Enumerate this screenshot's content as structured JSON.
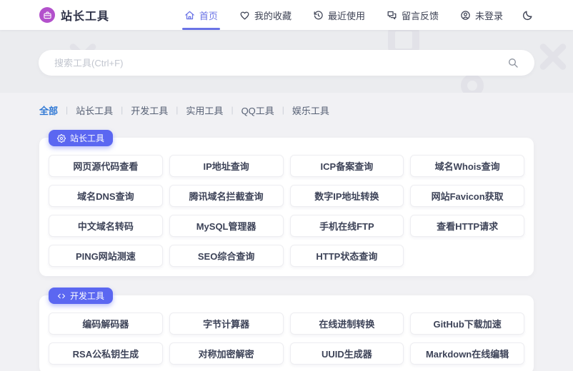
{
  "header": {
    "brand": "站长工具",
    "logo_icon": "toolbox-icon",
    "nav": [
      {
        "label": "首页",
        "icon": "home-icon",
        "active": true
      },
      {
        "label": "我的收藏",
        "icon": "heart-icon",
        "active": false
      },
      {
        "label": "最近使用",
        "icon": "history-icon",
        "active": false
      },
      {
        "label": "留言反馈",
        "icon": "feedback-icon",
        "active": false
      },
      {
        "label": "未登录",
        "icon": "user-icon",
        "active": false
      }
    ],
    "theme_toggle_icon": "moon-icon"
  },
  "search": {
    "placeholder": "搜索工具(Ctrl+F)",
    "icon": "search-icon"
  },
  "categories": {
    "active": "全部",
    "items": [
      "全部",
      "站长工具",
      "开发工具",
      "实用工具",
      "QQ工具",
      "娱乐工具"
    ]
  },
  "sections": [
    {
      "title": "站长工具",
      "icon": "gear-icon",
      "tools": [
        "网页源代码查看",
        "IP地址查询",
        "ICP备案查询",
        "域名Whois查询",
        "域名DNS查询",
        "腾讯域名拦截查询",
        "数字IP地址转换",
        "网站Favicon获取",
        "中文域名转码",
        "MySQL管理器",
        "手机在线FTP",
        "查看HTTP请求",
        "PING网站测速",
        "SEO综合查询",
        "HTTP状态查询"
      ]
    },
    {
      "title": "开发工具",
      "icon": "code-icon",
      "tools": [
        "编码解码器",
        "字节计算器",
        "在线进制转换",
        "GitHub下载加速",
        "RSA公私钥生成",
        "对称加密解密",
        "UUID生成器",
        "Markdown在线编辑"
      ]
    }
  ],
  "colors": {
    "brand_purple": "#b351cc",
    "accent_indigo": "#5b67f1",
    "nav_active": "#6a73e6",
    "category_active_blue": "#2f78d4",
    "page_background": "#f1f1f4",
    "banner_background": "#ebecef"
  }
}
